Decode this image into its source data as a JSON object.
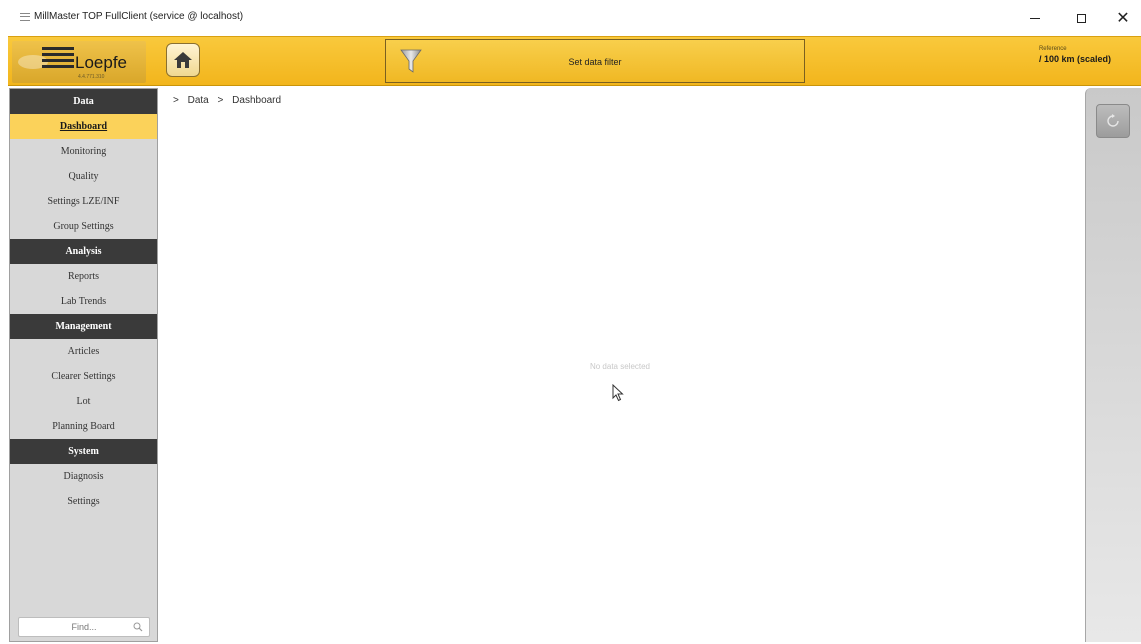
{
  "window": {
    "title": "MillMaster TOP FullClient (service @ localhost)",
    "minimize_label": "−",
    "maximize_label": "",
    "close_label": "✕"
  },
  "header": {
    "brand": "Loepfe",
    "version": "4.4.771.310",
    "filter_label": "Set data filter",
    "reference_small": "Reference",
    "reference_value": "/ 100 km (scaled)"
  },
  "nav": {
    "sections": [
      {
        "title": "Data",
        "items": [
          "Dashboard",
          "Monitoring",
          "Quality",
          "Settings LZE/INF",
          "Group Settings"
        ]
      },
      {
        "title": "Analysis",
        "items": [
          "Reports",
          "Lab Trends"
        ]
      },
      {
        "title": "Management",
        "items": [
          "Articles",
          "Clearer Settings",
          "Lot",
          "Planning Board"
        ]
      },
      {
        "title": "System",
        "items": [
          "Diagnosis",
          "Settings"
        ]
      }
    ],
    "active_item": "Dashboard",
    "find_placeholder": "Find..."
  },
  "breadcrumb": {
    "sep": ">",
    "items": [
      "Data",
      "Dashboard"
    ]
  },
  "main": {
    "empty_message": "No data selected"
  },
  "colors": {
    "header_yellow": "#f4bc28",
    "active_item": "#fbd25a",
    "section_dark": "#3a3a3a",
    "nav_bg": "#d8d8d8"
  },
  "icons": {
    "home": "home-icon",
    "filter": "funnel-icon",
    "search": "search-icon",
    "refresh": "refresh-icon",
    "cursor": "mouse-cursor-icon"
  }
}
